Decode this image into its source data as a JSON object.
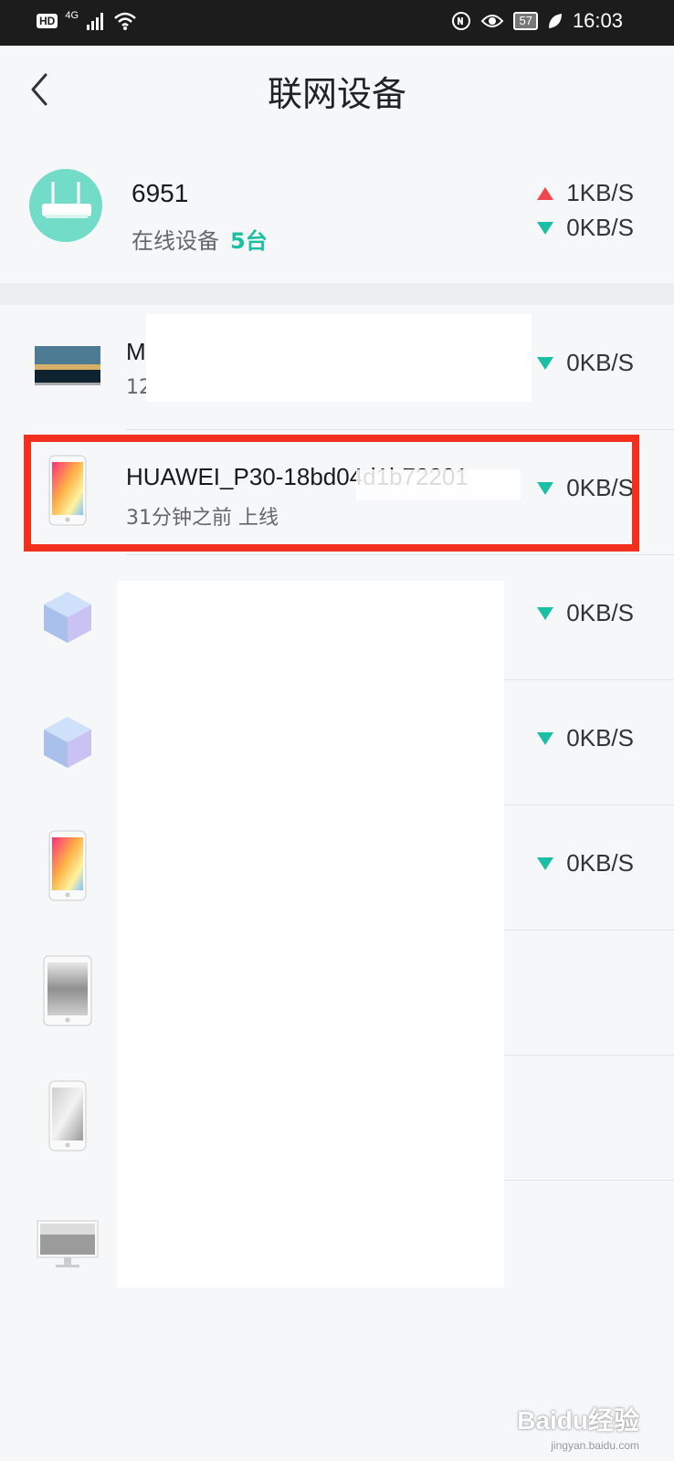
{
  "status_bar": {
    "hd_label": "HD",
    "network_label": "4G",
    "battery_level": "57",
    "time": "16:03"
  },
  "header": {
    "title": "联网设备"
  },
  "router": {
    "name": "6951",
    "online_label": "在线设备",
    "online_count": "5台",
    "upload_speed": "1KB/S",
    "download_speed": "0KB/S"
  },
  "devices": [
    {
      "name": "M",
      "sub": "12",
      "speed": "0KB/S",
      "icon": "monitor-landscape-icon"
    },
    {
      "name": "HUAWEI_P30-18bd04d1b72201",
      "sub": "31分钟之前 上线",
      "speed": "0KB/S",
      "icon": "phone-color-icon"
    },
    {
      "name": "",
      "sub": "",
      "speed": "0KB/S",
      "icon": "cube-device-icon"
    },
    {
      "name": "",
      "sub": "",
      "speed": "0KB/S",
      "icon": "cube-device-icon"
    },
    {
      "name": "",
      "sub": "",
      "speed": "0KB/S",
      "icon": "phone-color-icon"
    },
    {
      "name": "",
      "sub": "",
      "speed": "",
      "icon": "tablet-gray-icon"
    },
    {
      "name": "",
      "sub": "",
      "speed": "",
      "icon": "phone-gray-icon"
    },
    {
      "name": "",
      "sub": "",
      "speed": "",
      "icon": "desktop-monitor-icon"
    }
  ],
  "watermark": {
    "text": "Baidu经验",
    "sub": "jingyan.baidu.com"
  },
  "colors": {
    "accent": "#1bbfa4",
    "upload": "#f0464e",
    "highlight": "#f2301d"
  }
}
